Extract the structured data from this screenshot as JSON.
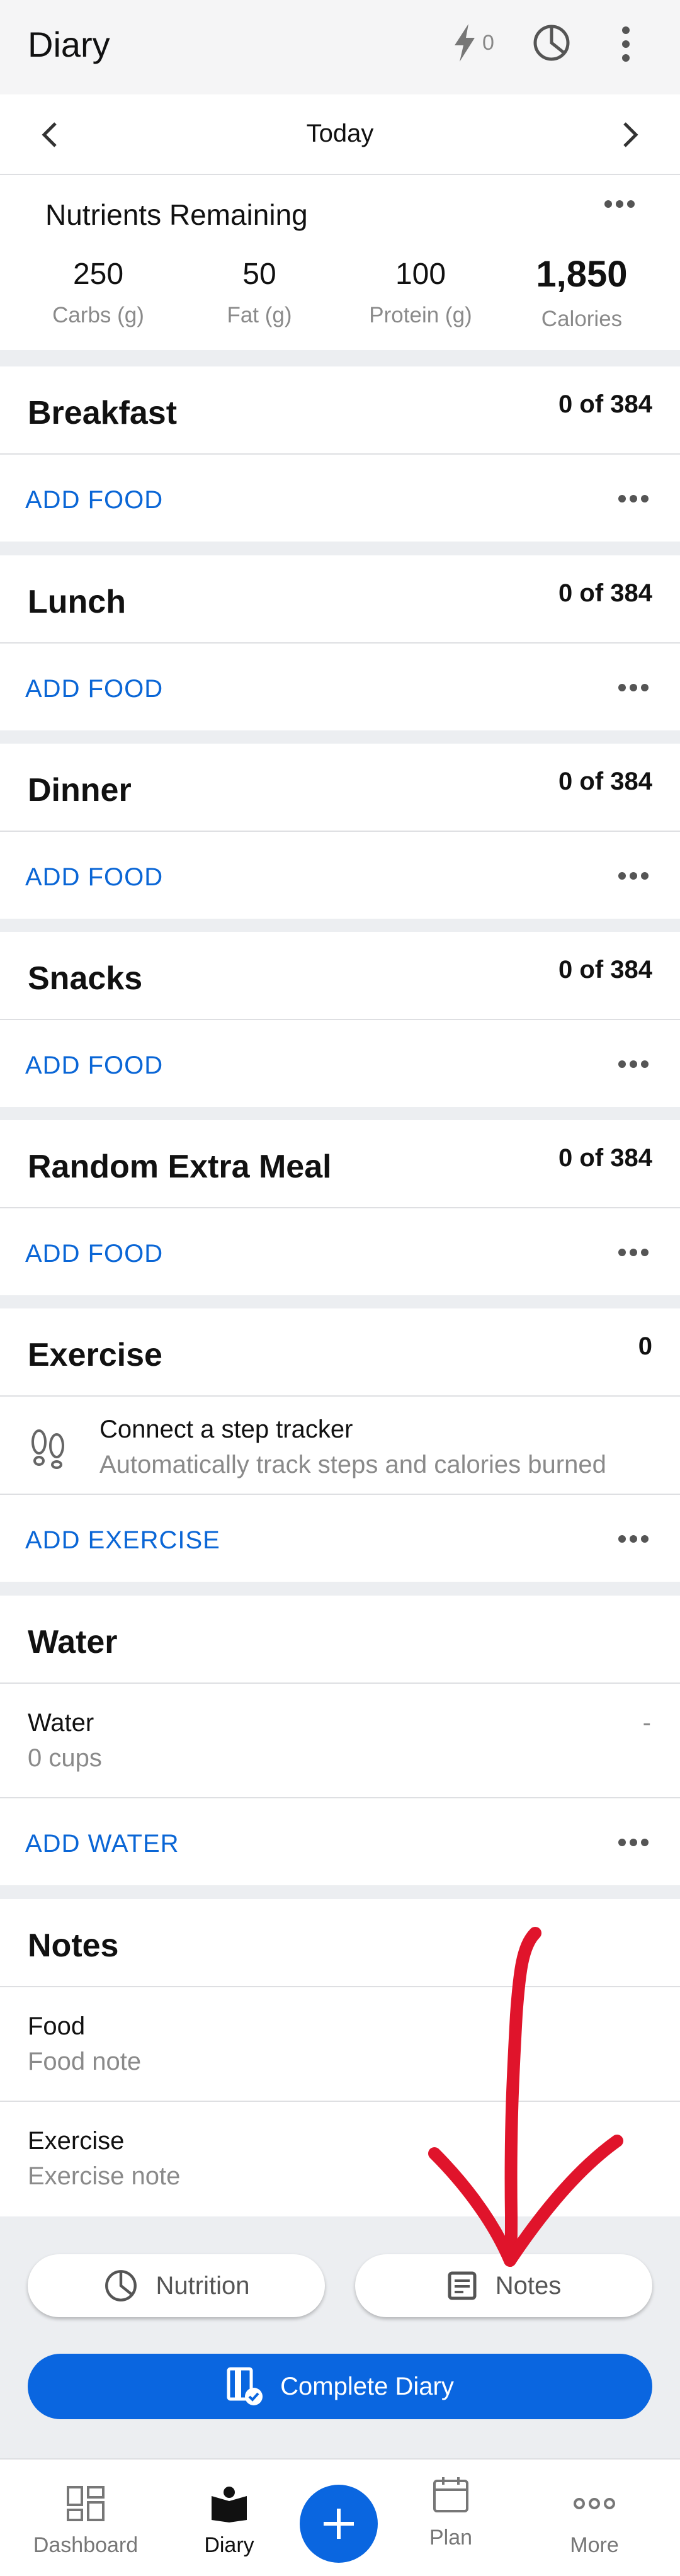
{
  "appbar": {
    "title": "Diary",
    "streak_count": "0"
  },
  "datenav": {
    "label": "Today"
  },
  "nutrients": {
    "title": "Nutrients Remaining",
    "items": [
      {
        "value": "250",
        "label": "Carbs (g)"
      },
      {
        "value": "50",
        "label": "Fat (g)"
      },
      {
        "value": "100",
        "label": "Protein (g)"
      },
      {
        "value": "1,850",
        "label": "Calories"
      }
    ]
  },
  "meals": [
    {
      "name": "Breakfast",
      "calories": "0 of 384",
      "action": "ADD FOOD"
    },
    {
      "name": "Lunch",
      "calories": "0 of 384",
      "action": "ADD FOOD"
    },
    {
      "name": "Dinner",
      "calories": "0 of 384",
      "action": "ADD FOOD"
    },
    {
      "name": "Snacks",
      "calories": "0 of 384",
      "action": "ADD FOOD"
    },
    {
      "name": "Random Extra Meal",
      "calories": "0 of 384",
      "action": "ADD FOOD"
    }
  ],
  "exercise": {
    "name": "Exercise",
    "calories": "0",
    "tracker_title": "Connect a step tracker",
    "tracker_subtitle": "Automatically track steps and calories burned",
    "action": "ADD EXERCISE"
  },
  "water": {
    "name": "Water",
    "row_title": "Water",
    "row_value": "0 cups",
    "row_right": "-",
    "action": "ADD WATER"
  },
  "notes": {
    "name": "Notes",
    "food_title": "Food",
    "food_placeholder": "Food note",
    "exercise_title": "Exercise",
    "exercise_placeholder": "Exercise note"
  },
  "buttons": {
    "nutrition": "Nutrition",
    "notes": "Notes",
    "complete": "Complete Diary"
  },
  "bottomnav": {
    "dashboard": "Dashboard",
    "diary": "Diary",
    "plan": "Plan",
    "more": "More"
  },
  "colors": {
    "accent": "#0a66e0",
    "link": "#0a66d6",
    "annotation": "#e0142b"
  }
}
